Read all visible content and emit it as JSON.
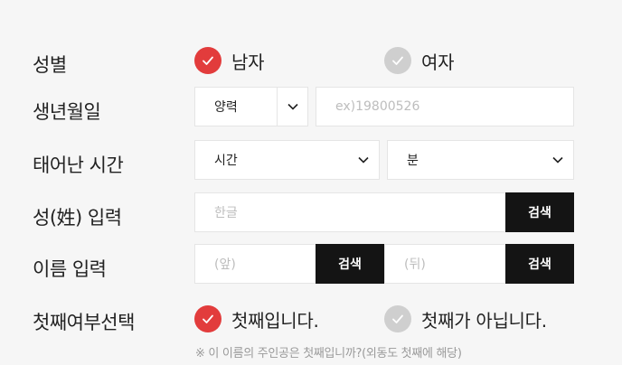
{
  "gender": {
    "label": "성별",
    "options": [
      {
        "label": "남자",
        "selected": true
      },
      {
        "label": "여자",
        "selected": false
      }
    ]
  },
  "birth": {
    "label": "생년월일",
    "calendar_value": "양력",
    "date_placeholder": "ex)19800526"
  },
  "birth_time": {
    "label": "태어난 시간",
    "hour_value": "시간",
    "minute_value": "분"
  },
  "surname": {
    "label": "성(姓) 입력",
    "placeholder": "한글",
    "search_label": "검색"
  },
  "name": {
    "label": "이름 입력",
    "front_placeholder": "(앞)",
    "back_placeholder": "(뒤)",
    "search_label": "검색"
  },
  "first_child": {
    "label": "첫째여부선택",
    "options": [
      {
        "label": "첫째입니다.",
        "selected": true
      },
      {
        "label": "첫째가 아닙니다.",
        "selected": false
      }
    ],
    "note": "※ 이 이름의 주인공은 첫째입니까?(외동도 첫째에 해당)"
  },
  "colors": {
    "accent": "#e23c3c",
    "unselected": "#cfcfcf",
    "button": "#141414",
    "background": "#f6f6f6"
  }
}
